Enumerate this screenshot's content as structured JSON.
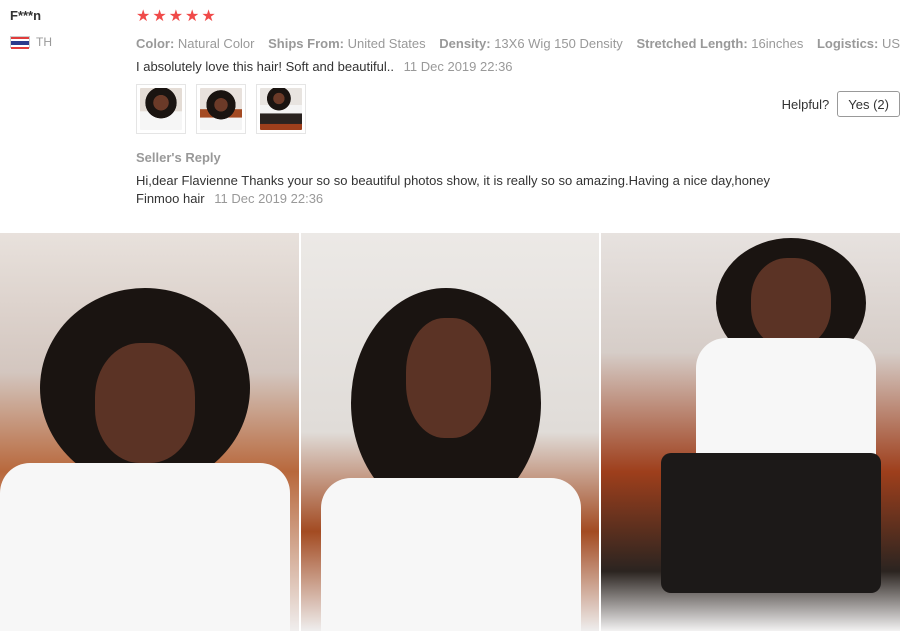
{
  "reviewer": {
    "name": "F***n",
    "country": "TH"
  },
  "review": {
    "stars": [
      "★",
      "★",
      "★",
      "★",
      "★"
    ],
    "attributes": [
      {
        "label": "Color:",
        "value": "Natural Color"
      },
      {
        "label": "Ships From:",
        "value": "United States"
      },
      {
        "label": "Density:",
        "value": "13X6 Wig 150 Density"
      },
      {
        "label": "Stretched Length:",
        "value": "16inches"
      },
      {
        "label": "Logistics:",
        "value": "USPS"
      }
    ],
    "text": "I absolutely love this hair! Soft and beautiful..",
    "date": "11 Dec 2019 22:36",
    "thumbnails": [
      "photo-1",
      "photo-2",
      "photo-3"
    ]
  },
  "helpful": {
    "label": "Helpful?",
    "yes_label": "Yes (2)"
  },
  "seller_reply": {
    "title": "Seller's Reply",
    "text": "Hi,dear Flavienne Thanks your so so beautiful photos show, it is really so so amazing.Having a nice day,honey",
    "author": "Finmoo hair",
    "date": "11 Dec 2019 22:36"
  },
  "colors": {
    "star": "#f04a49",
    "muted": "#999999",
    "text": "#333333"
  }
}
